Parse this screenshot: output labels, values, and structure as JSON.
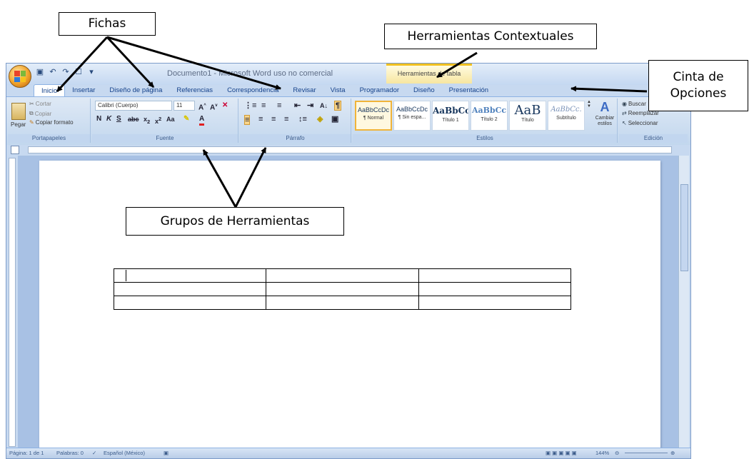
{
  "callouts": {
    "fichas": "Fichas",
    "contextual": "Herramientas Contextuales",
    "cinta": "Cinta de Opciones",
    "grupos": "Grupos de Herramientas"
  },
  "window": {
    "title": "Documento1 - Microsoft Word uso no comercial",
    "contextual_tools": "Herramientas de tabla"
  },
  "tabs": [
    "Inicio",
    "Insertar",
    "Diseño de página",
    "Referencias",
    "Correspondencia",
    "Revisar",
    "Vista",
    "Programador",
    "Diseño",
    "Presentación"
  ],
  "ribbon": {
    "clipboard": {
      "label": "Portapapeles",
      "paste": "Pegar",
      "cut": "Cortar",
      "copy": "Copiar",
      "format_painter": "Copiar formato"
    },
    "font": {
      "label": "Fuente",
      "font_name": "Calibri (Cuerpo)",
      "font_size": "11"
    },
    "paragraph": {
      "label": "Párrafo"
    },
    "styles": {
      "label": "Estilos",
      "items": [
        {
          "sample": "AaBbCcDc",
          "name": "¶ Normal"
        },
        {
          "sample": "AaBbCcDc",
          "name": "¶ Sin espa..."
        },
        {
          "sample": "AaBbCс",
          "name": "Título 1"
        },
        {
          "sample": "AaBbCc",
          "name": "Título 2"
        },
        {
          "sample": "AaB",
          "name": "Título"
        },
        {
          "sample": "AaBbCc.",
          "name": "Subtítulo"
        }
      ],
      "change_styles": "Cambiar estilos"
    },
    "editing": {
      "label": "Edición",
      "find": "Buscar",
      "replace": "Reemplazar",
      "select": "Seleccionar"
    }
  },
  "status": {
    "page": "Página: 1 de 1",
    "words": "Palabras: 0",
    "language": "Español (México)",
    "zoom": "144%"
  }
}
